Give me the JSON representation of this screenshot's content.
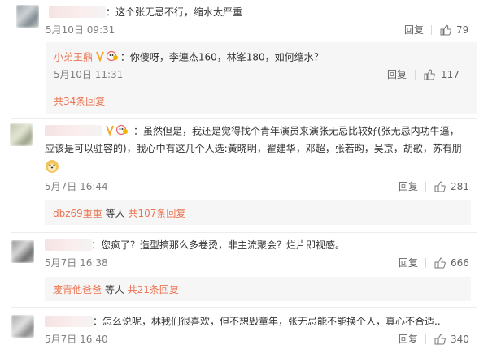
{
  "comments": [
    {
      "text": "：这个张无忌不行，缩水太严重",
      "time": "5月10日 09:31",
      "reply_label": "回复",
      "likes": "79",
      "sub_reply": {
        "username": "小弟王鼎",
        "text": "：你傻呀，李連杰160，林峯180，如何缩水？",
        "time": "5月10日 11:31",
        "reply_label": "回复",
        "likes": "117"
      },
      "more_replies": "共34条回复"
    },
    {
      "text_line1": "：虽然但是，我还是觉得找个青年演员来演张无忌比较好(张无忌内功牛逼，",
      "text_line2": "应该是可以驻容的)，我心中有这几个人选:黃晓明，翟建华，邓超，张若昀，吴京，胡歌，苏有朋",
      "emoji": "doge-emoji",
      "time": "5月7日 16:44",
      "reply_label": "回复",
      "likes": "281",
      "replier": "dbz69重重",
      "etc_label": " 等人 ",
      "more_replies": "共107条回复"
    },
    {
      "text": "：您疯了？造型搞那么多卷烫，非主流聚会？烂片即视感。",
      "time": "5月7日 16:38",
      "reply_label": "回复",
      "likes": "666",
      "replier": "废青他爸爸",
      "etc_label": " 等人 ",
      "more_replies": "共21条回复"
    },
    {
      "text": "：怎么说呢，林我们很喜欢，但不想毁童年，张无忌能不能换个人，真心不合适..",
      "time": "5月7日 16:40",
      "reply_label": "回复",
      "likes": "340"
    }
  ],
  "colors": {
    "link": "#eb7350",
    "time": "#808080",
    "divider": "#ececec",
    "subbox": "#f6f6f6"
  }
}
